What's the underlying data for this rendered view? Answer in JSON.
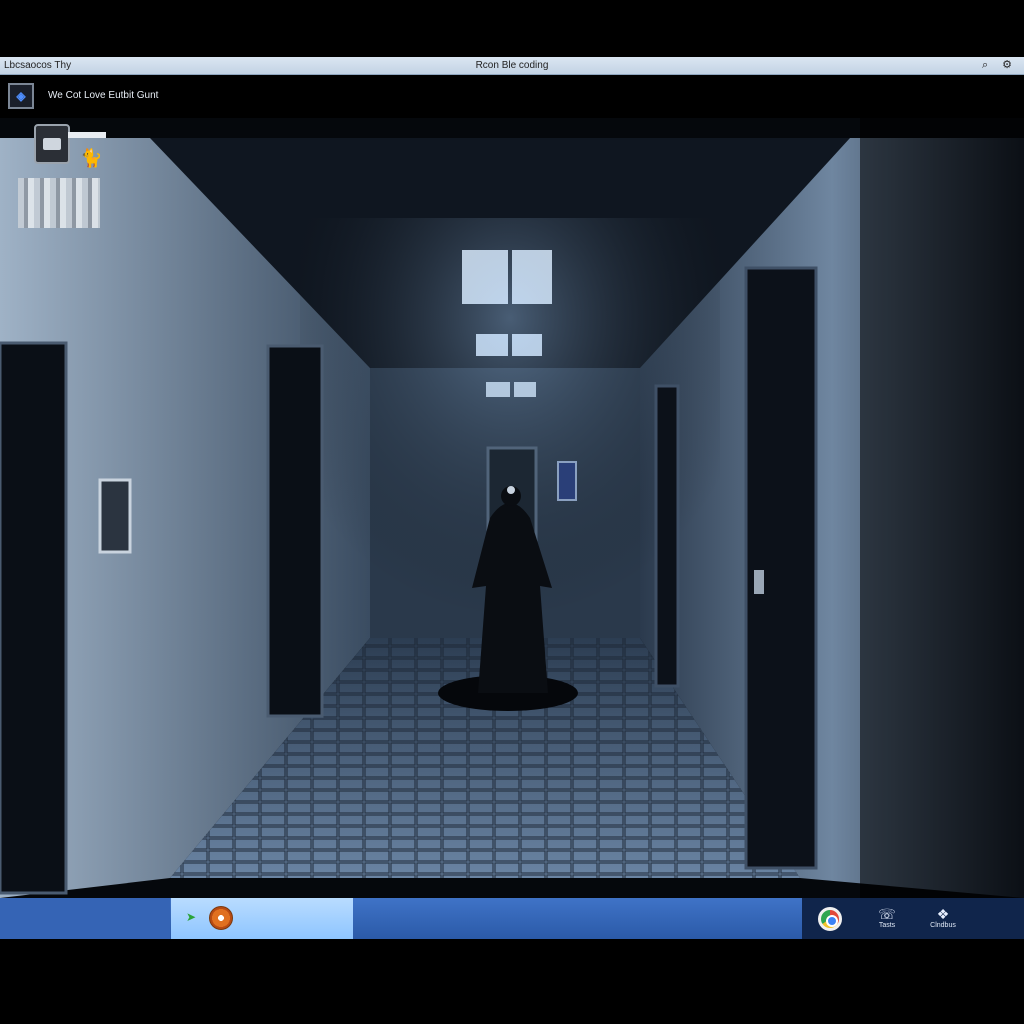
{
  "window": {
    "title_left": "Lbcsaocos  Thy",
    "title_center": "Rcon Ble coding",
    "search_icon": "search-icon",
    "settings_icon": "gear-icon"
  },
  "app": {
    "logo_text": "◈",
    "name": "We Cot Love Eutbit Gunt"
  },
  "hud": {
    "device_icon": "device-icon",
    "cat_icon": "🐈"
  },
  "taskbar": {
    "active_arrow": "➤",
    "tray_items": [
      {
        "icon": "network-icon",
        "glyph": "☏",
        "label": "Tasts"
      },
      {
        "icon": "folder-icon",
        "glyph": "❖",
        "label": "Clndbus"
      }
    ]
  }
}
